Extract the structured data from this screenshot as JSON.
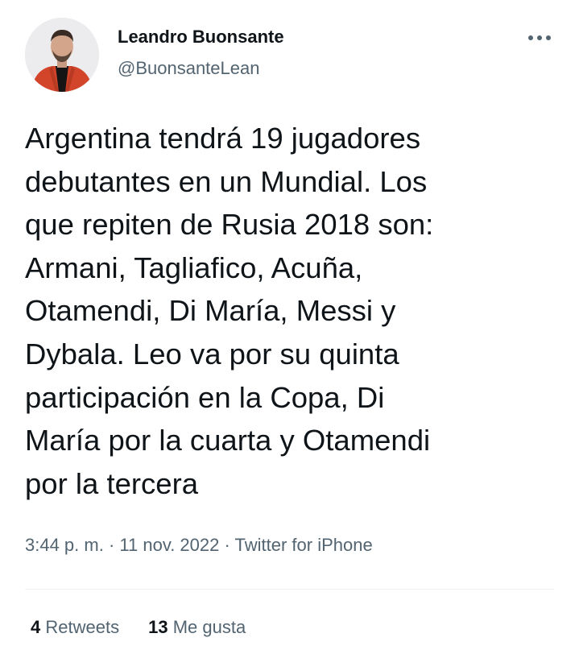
{
  "user": {
    "display_name": "Leandro Buonsante",
    "handle": "@BuonsanteLean",
    "avatar_icon": "user-avatar-photo"
  },
  "more_icon": "more-dots-icon",
  "tweet": {
    "text": "Argentina tendrá 19 jugadores\ndebutantes en un Mundial. Los\nque repiten de Rusia 2018 son:\nArmani, Tagliafico, Acuña,\nOtamendi, Di María, Messi y\nDybala. Leo va por su quinta\nparticipación en la Copa, Di\nMaría por la cuarta y Otamendi\npor la tercera"
  },
  "meta": {
    "time": "3:44 p. m.",
    "separator": " · ",
    "date": "11 nov. 2022",
    "source": "Twitter for iPhone"
  },
  "stats": {
    "retweets_count": "4",
    "retweets_label": "Retweets",
    "likes_count": "13",
    "likes_label": "Me gusta"
  },
  "colors": {
    "text_primary": "#0f1419",
    "text_secondary": "#536471",
    "divider": "#eff3f4",
    "background": "#ffffff"
  }
}
